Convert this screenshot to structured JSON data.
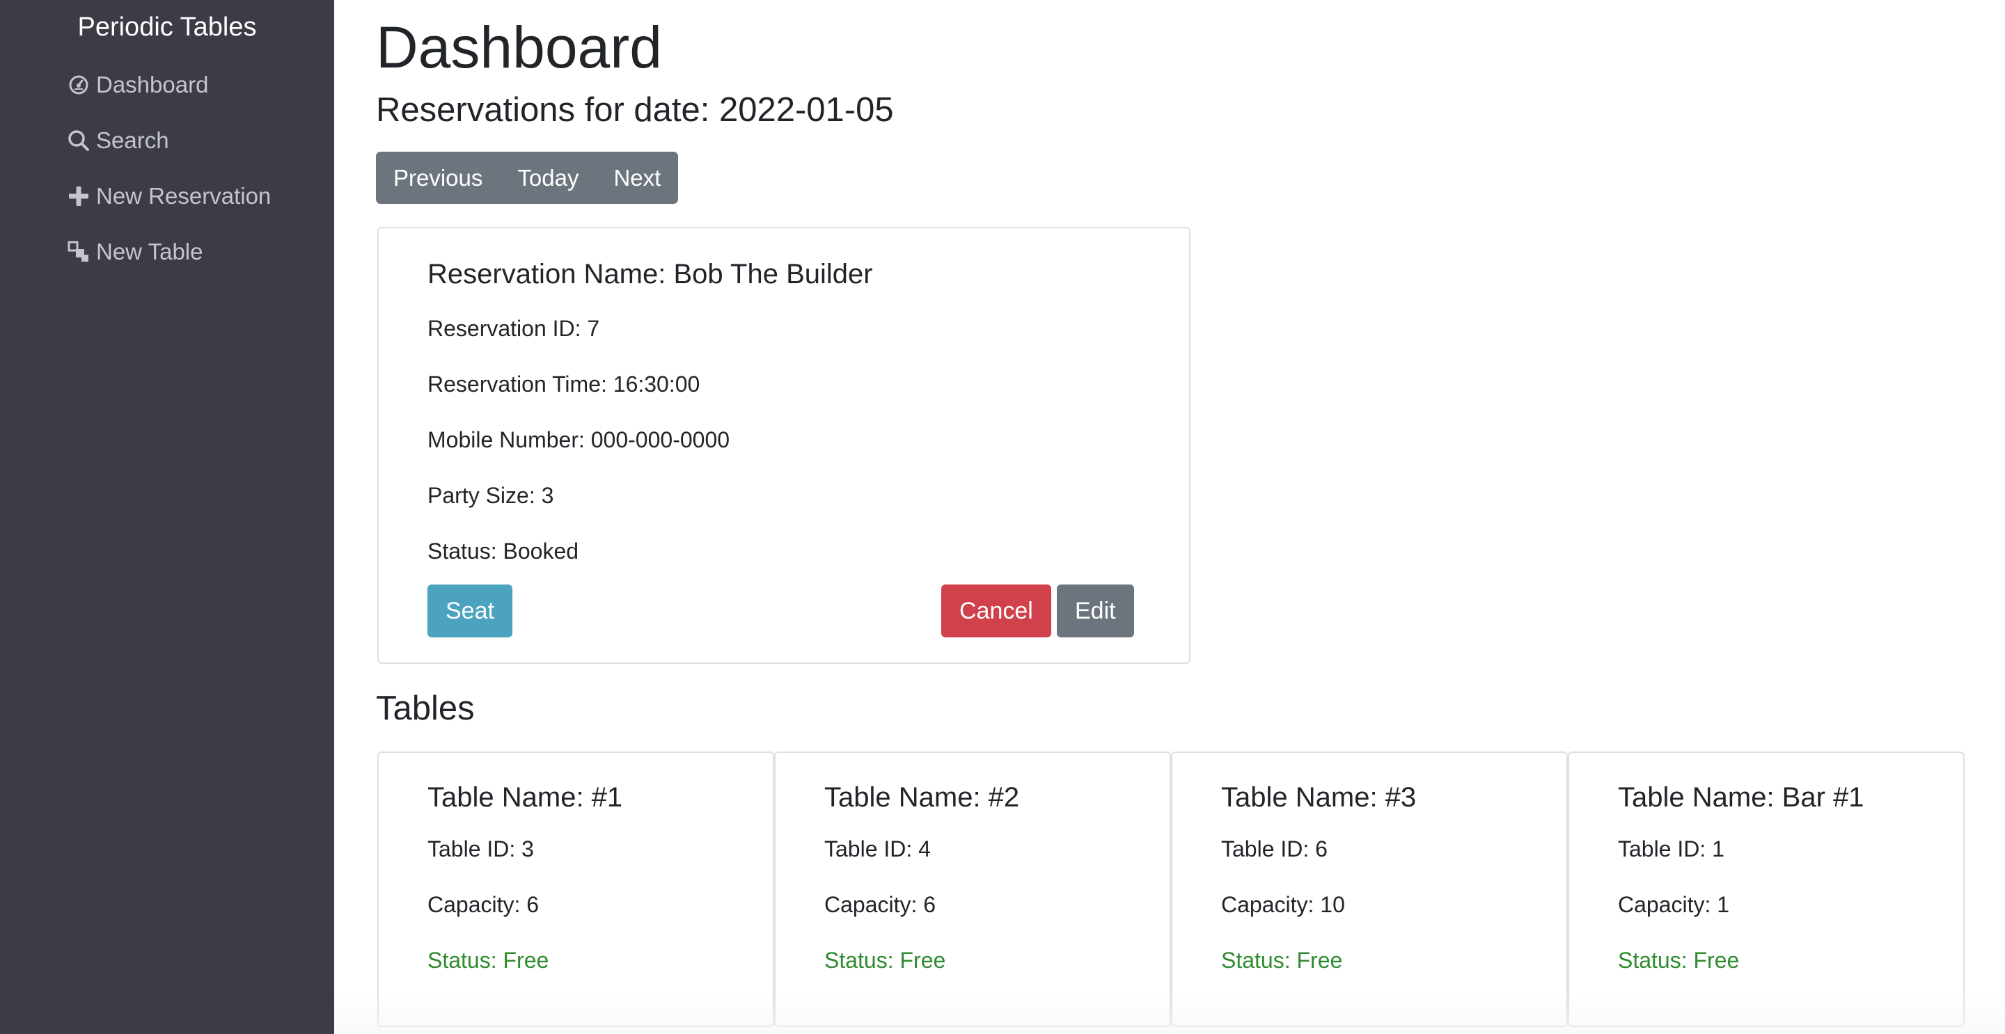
{
  "sidebar": {
    "brand": "Periodic Tables",
    "items": [
      {
        "label": "Dashboard",
        "icon": "dashboard-icon"
      },
      {
        "label": "Search",
        "icon": "search-icon"
      },
      {
        "label": "New Reservation",
        "icon": "plus-icon"
      },
      {
        "label": "New Table",
        "icon": "table-icon"
      }
    ]
  },
  "main": {
    "title": "Dashboard",
    "subtitle": "Reservations for date: 2022-01-05",
    "date_nav": {
      "previous": "Previous",
      "today": "Today",
      "next": "Next"
    },
    "reservation": {
      "title": "Reservation Name: Bob The Builder",
      "id": "Reservation ID: 7",
      "time": "Reservation Time: 16:30:00",
      "mobile": "Mobile Number: 000-000-0000",
      "party": "Party Size: 3",
      "status": "Status: Booked",
      "seat_label": "Seat",
      "cancel_label": "Cancel",
      "edit_label": "Edit"
    },
    "tables_title": "Tables",
    "tables": [
      {
        "name": "Table Name: #1",
        "id": "Table ID: 3",
        "capacity": "Capacity: 6",
        "status": "Status: Free"
      },
      {
        "name": "Table Name: #2",
        "id": "Table ID: 4",
        "capacity": "Capacity: 6",
        "status": "Status: Free"
      },
      {
        "name": "Table Name: #3",
        "id": "Table ID: 6",
        "capacity": "Capacity: 10",
        "status": "Status: Free"
      },
      {
        "name": "Table Name: Bar #1",
        "id": "Table ID: 1",
        "capacity": "Capacity: 1",
        "status": "Status: Free"
      }
    ]
  },
  "colors": {
    "sidebar_bg": "#3b3c46",
    "secondary": "#6c757d",
    "info": "#4ba3bf",
    "danger": "#d0414c",
    "success_text": "#2e8b2e"
  }
}
